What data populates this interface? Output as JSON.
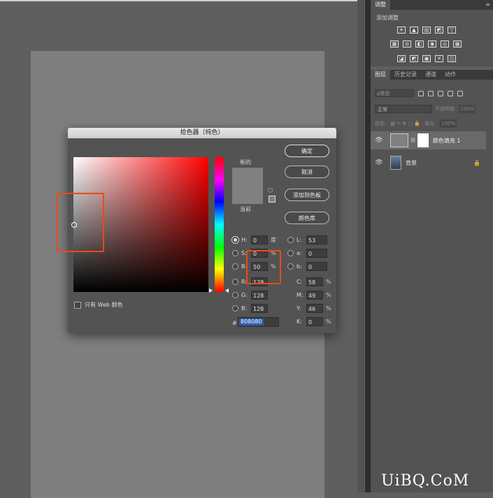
{
  "adjust_panel": {
    "tab": "调整",
    "subtitle": "添加调整",
    "row1": [
      "☀",
      "▲",
      "▤",
      "◩",
      "▽"
    ],
    "row2": [
      "▦",
      "⚖",
      "◧",
      "◉",
      "◎",
      "▦"
    ],
    "row3": [
      "◪",
      "◩",
      "▣",
      "✕",
      "◫"
    ]
  },
  "layers_panel": {
    "tabs": [
      "图层",
      "历史记录",
      "通道",
      "动作"
    ],
    "filter_placeholder": "ρ类型",
    "blend_mode": "正常",
    "opacity_label": "不透明度:",
    "opacity_value": "100%",
    "lock_label": "锁定:",
    "fill_label": "填充:",
    "fill_value": "100%",
    "layers": [
      {
        "name": "颜色填充 1"
      },
      {
        "name": "背景"
      }
    ]
  },
  "dialog": {
    "title": "拾色器（纯色）",
    "new_label": "新的",
    "current_label": "当前",
    "buttons": {
      "ok": "确定",
      "cancel": "取消",
      "add_swatch": "添加到色板",
      "color_lib": "颜色库"
    },
    "web_only": "只有 Web 颜色",
    "hsb": [
      {
        "label": "H:",
        "value": "0",
        "unit": "度"
      },
      {
        "label": "S:",
        "value": "0",
        "unit": "%"
      },
      {
        "label": "B:",
        "value": "50",
        "unit": "%"
      }
    ],
    "rgb": [
      {
        "label": "R:",
        "value": "128"
      },
      {
        "label": "G:",
        "value": "128"
      },
      {
        "label": "B:",
        "value": "128"
      }
    ],
    "lab": [
      {
        "label": "L:",
        "value": "53"
      },
      {
        "label": "a:",
        "value": "0"
      },
      {
        "label": "b:",
        "value": "0"
      }
    ],
    "cmyk": [
      {
        "label": "C:",
        "value": "58",
        "unit": "%"
      },
      {
        "label": "M:",
        "value": "49",
        "unit": "%"
      },
      {
        "label": "Y:",
        "value": "46",
        "unit": "%"
      },
      {
        "label": "K:",
        "value": "0",
        "unit": "%"
      }
    ],
    "hex_label": "#",
    "hex": "808080",
    "color": "#808080"
  },
  "watermark": "UiBQ.CoM"
}
